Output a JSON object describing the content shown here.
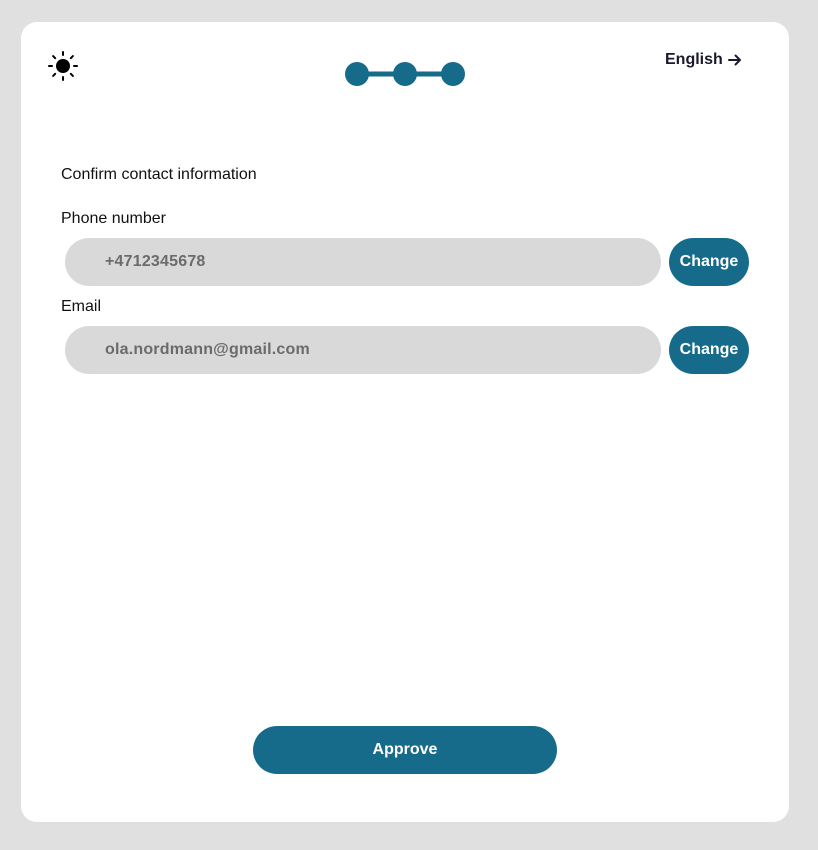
{
  "header": {
    "theme_icon": "sun-icon",
    "stepper": {
      "total_steps": 3,
      "current_step": 3,
      "color": "#166a8a"
    },
    "language": {
      "label": "English",
      "icon": "arrow-right-icon"
    }
  },
  "form": {
    "heading": "Confirm contact information",
    "phone": {
      "label": "Phone number",
      "value": "+4712345678",
      "change_label": "Change"
    },
    "email": {
      "label": "Email",
      "value": "ola.nordmann@gmail.com",
      "change_label": "Change"
    },
    "approve_label": "Approve"
  },
  "colors": {
    "accent": "#166a8a",
    "field_background": "#d9d9d9",
    "page_background": "#e0e0e0",
    "card_background": "#ffffff"
  }
}
